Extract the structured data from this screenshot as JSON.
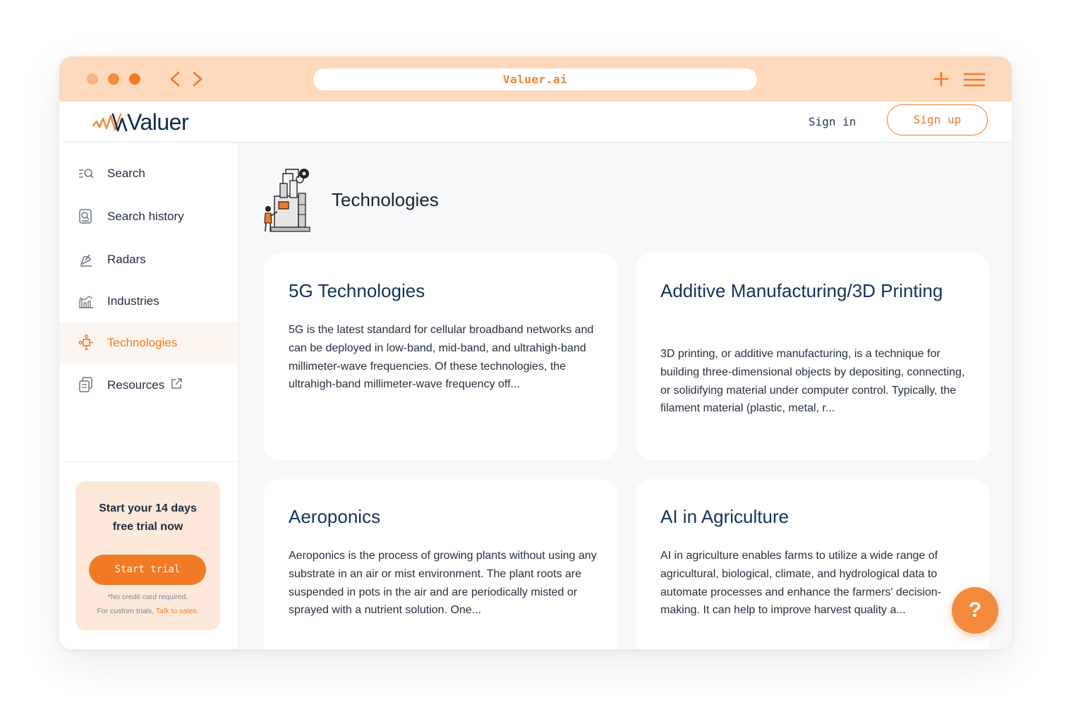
{
  "browser": {
    "url": "Valuer.ai"
  },
  "header": {
    "logo_text": "Valuer",
    "signin_label": "Sign in",
    "signup_label": "Sign up"
  },
  "sidebar": {
    "items": [
      {
        "label": "Search",
        "icon": "search-list-icon"
      },
      {
        "label": "Search history",
        "icon": "search-history-icon"
      },
      {
        "label": "Radars",
        "icon": "radar-icon"
      },
      {
        "label": "Industries",
        "icon": "industries-chart-icon"
      },
      {
        "label": "Technologies",
        "icon": "technologies-node-icon",
        "active": true
      },
      {
        "label": "Resources",
        "icon": "resources-icon",
        "external": true
      }
    ],
    "trial": {
      "title_line1": "Start your 14 days",
      "title_line2": "free trial now",
      "button_label": "Start trial",
      "note_line1": "*No credit card required.",
      "note_line2_prefix": "For custom trials, ",
      "note_link": "Talk to sales."
    }
  },
  "main": {
    "title": "Technologies",
    "cards": [
      {
        "title": "5G Technologies",
        "description": "5G is the latest standard for cellular broadband networks and can be deployed in low-band, mid-band, and ultrahigh-band millimeter-wave frequencies. Of these technologies, the ultrahigh-band millimeter-wave frequency off..."
      },
      {
        "title": "Additive Manufacturing/3D Printing",
        "description": "3D printing, or additive manufacturing, is a technique for building three-dimensional objects by depositing, connecting, or solidifying material under computer control. Typically, the filament material (plastic, metal, r..."
      },
      {
        "title": "Aeroponics",
        "description": "Aeroponics is the process of growing plants without using any substrate in an air or mist environment. The plant roots are suspended in pots in the air and are periodically misted or sprayed with a nutrient solution. One..."
      },
      {
        "title": "AI in Agriculture",
        "description": "AI in agriculture enables farms to utilize a wide range of agricultural, biological, climate, and hydrological data to automate processes and enhance the farmers' decision-making. It can help to improve harvest quality a..."
      }
    ]
  },
  "help_button": {
    "label": "?"
  },
  "colors": {
    "accent": "#f37a24",
    "chrome": "#fdd9bd",
    "navy": "#15325d",
    "trial_bg": "#fde8da"
  }
}
